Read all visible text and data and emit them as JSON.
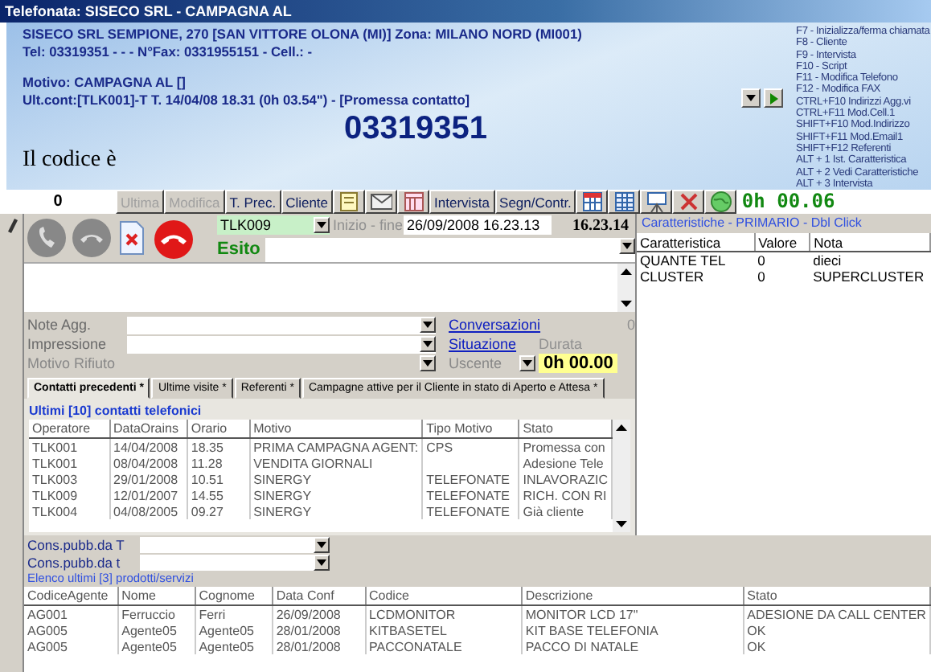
{
  "window": {
    "title": "Telefonata: SISECO SRL - CAMPAGNA AL"
  },
  "header": {
    "address": "SISECO SRL SEMPIONE, 270 [SAN VITTORE OLONA (MI)] Zona: MILANO NORD (MI001)",
    "phones": "Tel: 03319351 -  -  - N°Fax: 0331955151 - Cell.:  -",
    "motivo": "Motivo: CAMPAGNA AL []",
    "last_contact": "Ult.cont:[TLK001]-T T. 14/04/08 18.31 (0h 03.54\") - [Promessa contatto]",
    "number": "03319351",
    "message": "Il codice è"
  },
  "shortcuts": [
    "F7  - Inizializza/ferma chiamata",
    "F8  - Cliente",
    "F9  - Intervista",
    "F10 - Script",
    "F11 - Modifica Telefono",
    "F12 - Modifica FAX",
    "CTRL+F10 Indirizzi Agg.vi",
    "CTRL+F11 Mod.Cell.1",
    "SHIFT+F10 Mod.Indirizzo",
    "SHIFT+F11 Mod.Email1",
    "SHIFT+F12 Referenti",
    "ALT + 1 Ist. Caratteristica",
    "ALT + 2 Vedi Caratteristiche",
    "ALT + 3 Intervista"
  ],
  "toolbar": {
    "counter": "0",
    "timer": "0h 00.06",
    "buttons": [
      {
        "kind": "text",
        "label": "Ultima",
        "disabled": true
      },
      {
        "kind": "text",
        "label": "Modifica",
        "disabled": true
      },
      {
        "kind": "text",
        "label": "T. Prec.",
        "disabled": false
      },
      {
        "kind": "text",
        "label": "Cliente",
        "disabled": false
      },
      {
        "kind": "icon",
        "disabled": false
      },
      {
        "kind": "icon",
        "disabled": false
      },
      {
        "kind": "icon",
        "disabled": false
      },
      {
        "kind": "text",
        "label": "Intervista",
        "disabled": false
      },
      {
        "kind": "text",
        "label": "Segn/Contr.",
        "disabled": false
      },
      {
        "kind": "icon",
        "disabled": false
      },
      {
        "kind": "icon",
        "disabled": false
      },
      {
        "kind": "icon",
        "disabled": false
      },
      {
        "kind": "icon",
        "disabled": false
      },
      {
        "kind": "icon",
        "disabled": false
      }
    ]
  },
  "call": {
    "operator": "TLK009",
    "time_label": "Inizio - fine",
    "start": "26/09/2008 16.23.13",
    "end": "16.23.14",
    "esito_label": "Esito"
  },
  "fields": [
    {
      "label": "Note Agg.",
      "disabled": false
    },
    {
      "label": "Impressione",
      "disabled": false
    },
    {
      "label": "Motivo Rifiuto",
      "disabled": true
    }
  ],
  "links": {
    "conversazioni": "Conversazioni",
    "count": "0",
    "situazione": "Situazione",
    "durata_label": "Durata",
    "uscente": "Uscente",
    "durata": "0h 00.00"
  },
  "tabs": [
    {
      "label": "Contatti precedenti *",
      "selected": true
    },
    {
      "label": "Ultime visite *",
      "selected": false
    },
    {
      "label": "Referenti *",
      "selected": false
    },
    {
      "label": "Campagne attive per il Cliente in stato di Aperto e Attesa *",
      "selected": false
    }
  ],
  "contacts": {
    "caption": "Ultimi [10] contatti telefonici",
    "columns": [
      "Operatore",
      "DataOrains",
      "Orario",
      "Motivo",
      "Tipo Motivo",
      "Stato"
    ],
    "rows": [
      [
        "TLK001",
        "14/04/2008",
        "18.35",
        "PRIMA CAMPAGNA AGENT:",
        "CPS",
        "Promessa con"
      ],
      [
        "TLK001",
        "08/04/2008",
        "11.28",
        "VENDITA GIORNALI",
        "",
        "Adesione Tele"
      ],
      [
        "TLK003",
        "29/01/2008",
        "10.51",
        "SINERGY",
        "TELEFONATE",
        "INLAVORAZIC"
      ],
      [
        "TLK009",
        "12/01/2007",
        "14.55",
        "SINERGY",
        "TELEFONATE",
        "RICH. CON RI"
      ],
      [
        "TLK004",
        "04/08/2005",
        "09.27",
        "SINERGY",
        "TELEFONATE",
        "Già cliente"
      ]
    ]
  },
  "characteristics": {
    "caption": "Caratteristiche - PRIMARIO - Dbl Click",
    "columns": [
      "Caratteristica",
      "Valore",
      "Nota"
    ],
    "rows": [
      [
        "QUANTE TEL",
        "0",
        "dieci"
      ],
      [
        "CLUSTER",
        "0",
        "SUPERCLUSTER"
      ]
    ]
  },
  "cons_fields": [
    "Cons.pubb.da T",
    "Cons.pubb.da t"
  ],
  "products": {
    "caption": "Elenco ultimi [3] prodotti/servizi",
    "columns": [
      "CodiceAgente",
      "Nome",
      "Cognome",
      "Data Conf",
      "Codice",
      "Descrizione",
      "Stato"
    ],
    "rows": [
      [
        "AG001",
        "Ferruccio",
        "Ferri",
        "26/09/2008",
        "LCDMONITOR",
        "MONITOR LCD 17\"",
        "ADESIONE DA CALL CENTER"
      ],
      [
        "AG005",
        "Agente05",
        "Agente05",
        "28/01/2008",
        "KITBASETEL",
        "KIT BASE TELEFONIA",
        "OK"
      ],
      [
        "AG005",
        "Agente05",
        "Agente05",
        "28/01/2008",
        "PACCONATALE",
        "PACCO DI NATALE",
        "OK"
      ]
    ]
  }
}
